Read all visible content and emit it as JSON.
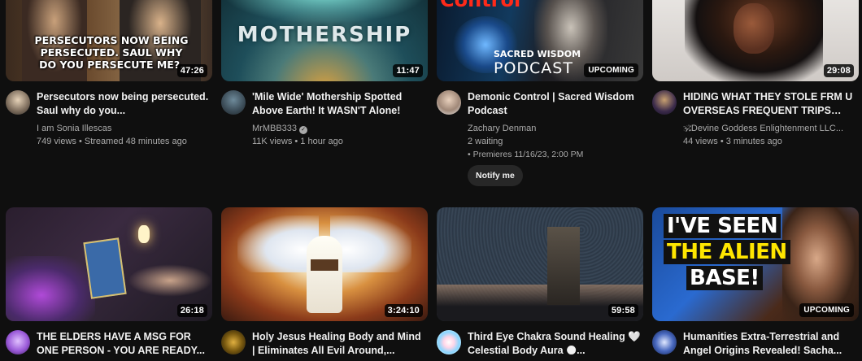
{
  "videos": [
    {
      "title": "Persecutors now being persecuted. Saul why do you...",
      "channel": "I am Sonia Illescas",
      "stats": "749 views • Streamed 48 minutes ago",
      "duration": "47:26",
      "thumb_text": "PERSECUTORS NOW BEING PERSECUTED. SAUL WHY DO YOU PERSECUTE ME?."
    },
    {
      "title": "'Mile Wide' Mothership Spotted Above Earth! It WASN'T Alone!",
      "channel": "MrMBB333",
      "stats": "11K views • 1 hour ago",
      "duration": "11:47",
      "thumb_text": "MOTHERSHIP"
    },
    {
      "title": "Demonic Control | Sacred Wisdom Podcast",
      "channel": "Zachary Denman",
      "waiting": "2 waiting",
      "premiere": "• Premieres 11/16/23, 2:00 PM",
      "notify": "Notify me",
      "duration": "UPCOMING",
      "thumb_text_1": "Control",
      "thumb_text_2": "SACRED WISDOM",
      "thumb_text_3": "PODCAST"
    },
    {
      "title": "HIDING WHAT THEY STOLE FRM U OVERSEAS FREQUENT TRIPS OU...",
      "channel": "🕉Devine Goddess Enlightenment LLC...",
      "stats": "44 views • 3 minutes ago",
      "duration": "29:08"
    },
    {
      "title": "THE ELDERS HAVE A MSG FOR ONE PERSON - YOU ARE READY...",
      "duration": "26:18"
    },
    {
      "title": "Holy Jesus Healing Body and Mind | Eliminates All Evil Around,...",
      "duration": "3:24:10"
    },
    {
      "title": "Third Eye Chakra Sound Healing 🤍 Celestial Body Aura 🌑...",
      "duration": "59:58"
    },
    {
      "title": "Humanities Extra-Terrestrial and Angel Origins Revealed! Sacha...",
      "duration": "UPCOMING",
      "thumb_text_1": "I'VE SEEN",
      "thumb_text_2": "THE ALIEN",
      "thumb_text_3": "BASE!"
    }
  ],
  "colors": {
    "background": "#0f0f0f",
    "title": "#f1f1f1",
    "secondary": "#aaaaaa",
    "button": "#272727",
    "alien_yellow": "#ffe600"
  }
}
